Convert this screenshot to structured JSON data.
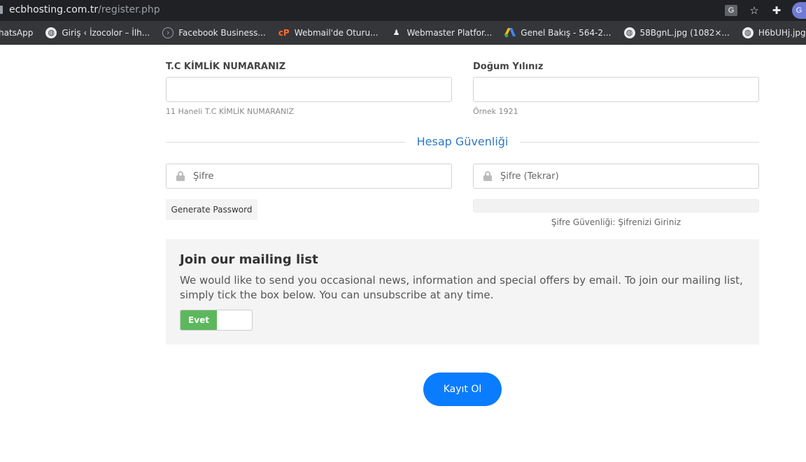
{
  "browser": {
    "url_host": "ecbhosting.com.tr",
    "url_path": "/register.php",
    "bookmarks": [
      {
        "label": "hatsApp",
        "icon": "whatsapp-icon"
      },
      {
        "label": "Giriş ‹ İzocolor – İlh...",
        "icon": "globe-icon"
      },
      {
        "label": "Facebook Business...",
        "icon": "facebook-icon"
      },
      {
        "label": "Webmail'de Oturu...",
        "icon": "cpanel-icon"
      },
      {
        "label": "Webmaster Platfor...",
        "icon": "webmaster-icon"
      },
      {
        "label": "Genel Bakış - 564-2...",
        "icon": "google-ads-icon"
      },
      {
        "label": "58BgnL.jpg (1082×...",
        "icon": "globe-icon"
      },
      {
        "label": "H6bUHj.jpg (1082×...",
        "icon": "globe-icon"
      }
    ]
  },
  "form": {
    "tc_label": "T.C KİMLİK NUMARANIZ",
    "tc_value": "",
    "tc_hint": "11 Haneli T.C KİMLİK NUMARANIZ",
    "birth_label": "Doğum Yılınız",
    "birth_value": "",
    "birth_hint": "Örnek 1921",
    "security_title": "Hesap Güvenliği",
    "password_placeholder": "Şifre",
    "password_repeat_placeholder": "Şifre (Tekrar)",
    "generate_label": "Generate Password",
    "strength_text": "Şifre Güvenliği: Şifrenizi Giriniz"
  },
  "mailing": {
    "title": "Join our mailing list",
    "text": "We would like to send you occasional news, information and special offers by email. To join our mailing list, simply tick the box below. You can unsubscribe at any time.",
    "toggle_label": "Evet"
  },
  "submit_label": "Kayıt Ol"
}
